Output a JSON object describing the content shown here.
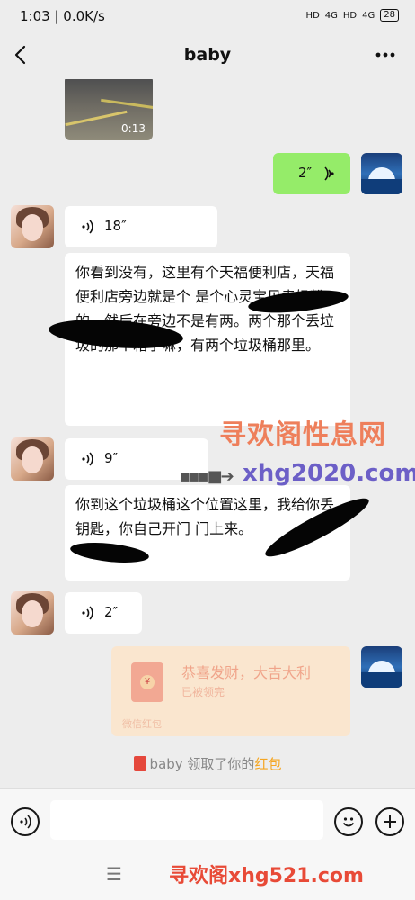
{
  "status": {
    "time": "1:03 | 0.0K/s",
    "net1": "HD",
    "sig1": "4G",
    "net2": "HD",
    "sig2": "4G",
    "battery": "28"
  },
  "header": {
    "title": "baby",
    "back_icon": "back-arrow-icon",
    "more_icon": "more-dots-icon"
  },
  "messages": {
    "video": {
      "duration": "0:13"
    },
    "voice_sent": {
      "duration": "2″"
    },
    "voice1": {
      "duration": "18″"
    },
    "text1": "你看到没有，这里有个天福便利店，天福便利店旁边就是个                  是个心灵宝贝卖奶粉的。然后在旁边不是有两。两个那个丢垃圾的那个箱子嘛，有两个垃圾桶那里。",
    "voice2": {
      "duration": "9″"
    },
    "text2": "你到这个垃圾桶这个位置这里，我给你丢钥匙，你自己开门           门上来。",
    "voice3": {
      "duration": "2″"
    },
    "red_packet": {
      "title": "恭喜发财，大吉大利",
      "status": "已被领完",
      "footer": "微信红包"
    },
    "system_note": {
      "prefix": "baby 领取了你的",
      "highlight": "红包"
    }
  },
  "watermarks": {
    "site_name": "寻欢阁性息网",
    "site_url": "xhg2020.com",
    "bottom": "寻欢阁xhg521.com"
  },
  "colors": {
    "background": "#ededed",
    "self_bubble": "#95ec69",
    "other_bubble": "#ffffff",
    "red_packet": "#fae6cf"
  }
}
